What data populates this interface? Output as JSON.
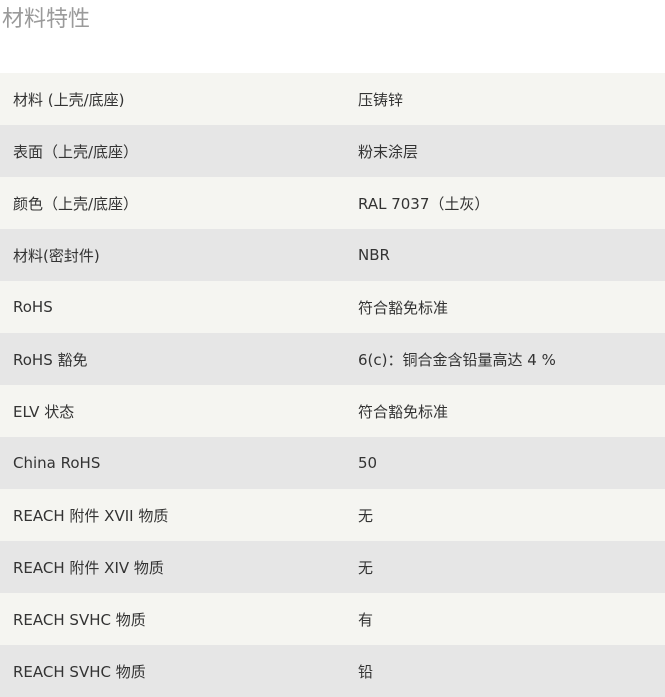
{
  "page": {
    "title": "材料特性"
  },
  "rows": [
    {
      "label": "材料 (上壳/底座)",
      "value": "压铸锌"
    },
    {
      "label": "表面（上壳/底座）",
      "value": "粉末涂层"
    },
    {
      "label": "颜色（上壳/底座）",
      "value": "RAL 7037（土灰）"
    },
    {
      "label": "材料(密封件)",
      "value": "NBR"
    },
    {
      "label": "RoHS",
      "value": "符合豁免标准"
    },
    {
      "label": "RoHS 豁免",
      "value": "6(c)：铜合金含铅量高达 4 %"
    },
    {
      "label": "ELV 状态",
      "value": "符合豁免标准"
    },
    {
      "label": "China RoHS",
      "value": "50"
    },
    {
      "label": "REACH 附件 XVII 物质",
      "value": "无"
    },
    {
      "label": "REACH 附件 XIV 物质",
      "value": "无"
    },
    {
      "label": "REACH SVHC 物质",
      "value": "有"
    },
    {
      "label": "REACH SVHC 物质",
      "value": "铅"
    }
  ]
}
